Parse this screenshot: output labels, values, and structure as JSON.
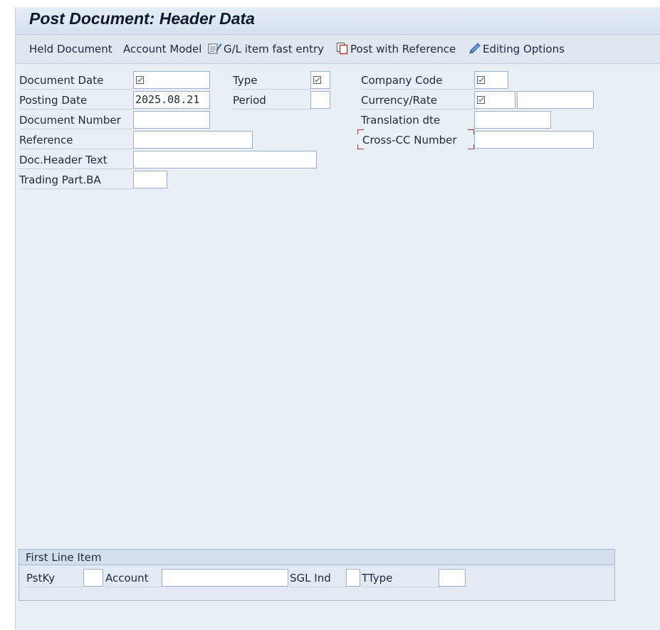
{
  "title": "Post Document: Header Data",
  "toolbar": {
    "held_document": "Held Document",
    "account_model": "Account Model",
    "gl_fast_entry": "G/L item fast entry",
    "post_with_reference": "Post with Reference",
    "editing_options": "Editing Options"
  },
  "form": {
    "document_date": {
      "label": "Document Date",
      "value": ""
    },
    "posting_date": {
      "label": "Posting Date",
      "value": "2025.08.21"
    },
    "document_number": {
      "label": "Document Number",
      "value": ""
    },
    "reference": {
      "label": "Reference",
      "value": ""
    },
    "doc_header_text": {
      "label": "Doc.Header Text",
      "value": ""
    },
    "trading_part_ba": {
      "label": "Trading Part.BA",
      "value": ""
    },
    "type": {
      "label": "Type",
      "value": ""
    },
    "period": {
      "label": "Period",
      "value": ""
    },
    "company_code": {
      "label": "Company Code",
      "value": ""
    },
    "currency_rate": {
      "label": "Currency/Rate",
      "value": "",
      "rate": ""
    },
    "translation_dte": {
      "label": "Translation dte",
      "value": ""
    },
    "cross_cc_number": {
      "label": "Cross-CC Number",
      "value": ""
    }
  },
  "first_line_item": {
    "title": "First Line Item",
    "pstky": {
      "label": "PstKy",
      "value": ""
    },
    "account": {
      "label": "Account",
      "value": ""
    },
    "sgl_ind": {
      "label": "SGL Ind",
      "value": ""
    },
    "ttype": {
      "label": "TType",
      "value": ""
    }
  }
}
